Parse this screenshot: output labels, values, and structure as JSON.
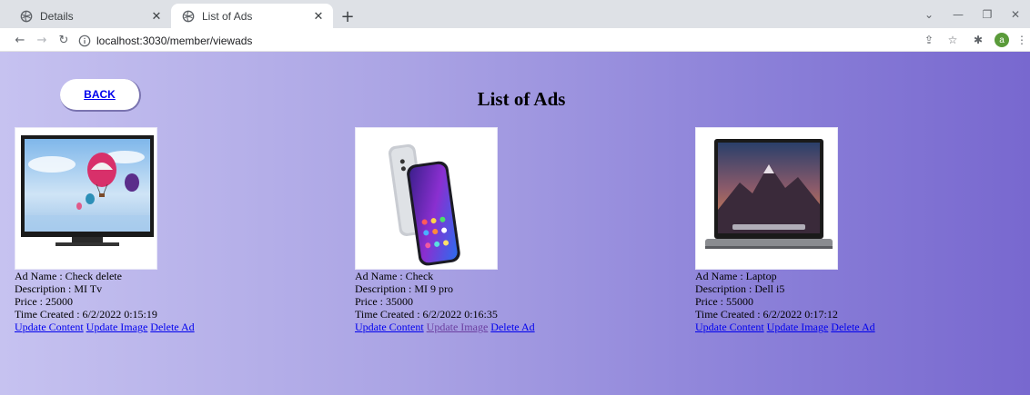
{
  "browser": {
    "tabs": [
      {
        "title": "Details",
        "active": false
      },
      {
        "title": "List of Ads",
        "active": true
      }
    ],
    "url": "localhost:3030/member/viewads",
    "profile_initial": "a"
  },
  "page": {
    "back_label": "BACK",
    "title": "List of Ads"
  },
  "ads": [
    {
      "name_line": "Ad Name : Check delete",
      "description_line": "Description : MI Tv",
      "price_line": "Price : 25000",
      "time_line": "Time Created : 6/2/2022 0:15:19",
      "update_content": "Update Content",
      "update_image": "Update Image",
      "delete_ad": "Delete Ad",
      "image": "tv-image"
    },
    {
      "name_line": "Ad Name : Check",
      "description_line": "Description : MI 9 pro",
      "price_line": "Price : 35000",
      "time_line": "Time Created : 6/2/2022 0:16:35",
      "update_content": "Update Content",
      "update_image": "Update Image",
      "delete_ad": "Delete Ad",
      "image": "phone-image"
    },
    {
      "name_line": "Ad Name : Laptop",
      "description_line": "Description : Dell i5",
      "price_line": "Price : 55000",
      "time_line": "Time Created : 6/2/2022 0:17:12",
      "update_content": "Update Content",
      "update_image": "Update Image",
      "delete_ad": "Delete Ad",
      "image": "laptop-image"
    }
  ],
  "colors": {
    "link": "#0000ee",
    "visited_link": "#6b3ea0",
    "gradient_start": "#c6c2f0",
    "gradient_end": "#7868cf"
  }
}
